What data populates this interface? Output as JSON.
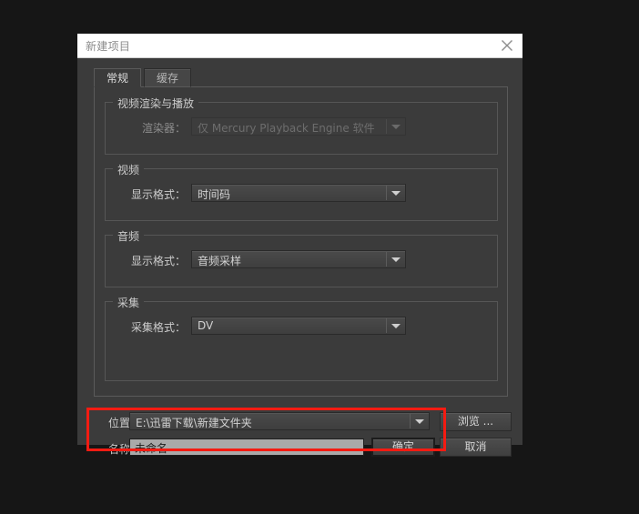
{
  "window": {
    "title": "新建项目",
    "close_icon": "close-icon"
  },
  "tabs": [
    {
      "label": "常规",
      "active": true
    },
    {
      "label": "缓存",
      "active": false
    }
  ],
  "groups": {
    "video_render": {
      "legend": "视频渲染与播放",
      "field_label": "渲染器：",
      "value": "仅 Mercury Playback Engine 软件",
      "disabled": true
    },
    "video": {
      "legend": "视频",
      "field_label": "显示格式：",
      "value": "时间码",
      "disabled": false
    },
    "audio": {
      "legend": "音频",
      "field_label": "显示格式：",
      "value": "音频采样",
      "disabled": false
    },
    "capture": {
      "legend": "采集",
      "field_label": "采集格式：",
      "value": "DV",
      "disabled": false
    }
  },
  "bottom": {
    "location_label": "位置：",
    "location_value": "E:\\迅雷下载\\新建文件夹",
    "name_label": "名称：",
    "name_value": "未命名",
    "browse_button": "浏览 ...",
    "ok_button": "确定",
    "cancel_button": "取消"
  },
  "annotation": {
    "highlight_color": "#f41b12"
  }
}
